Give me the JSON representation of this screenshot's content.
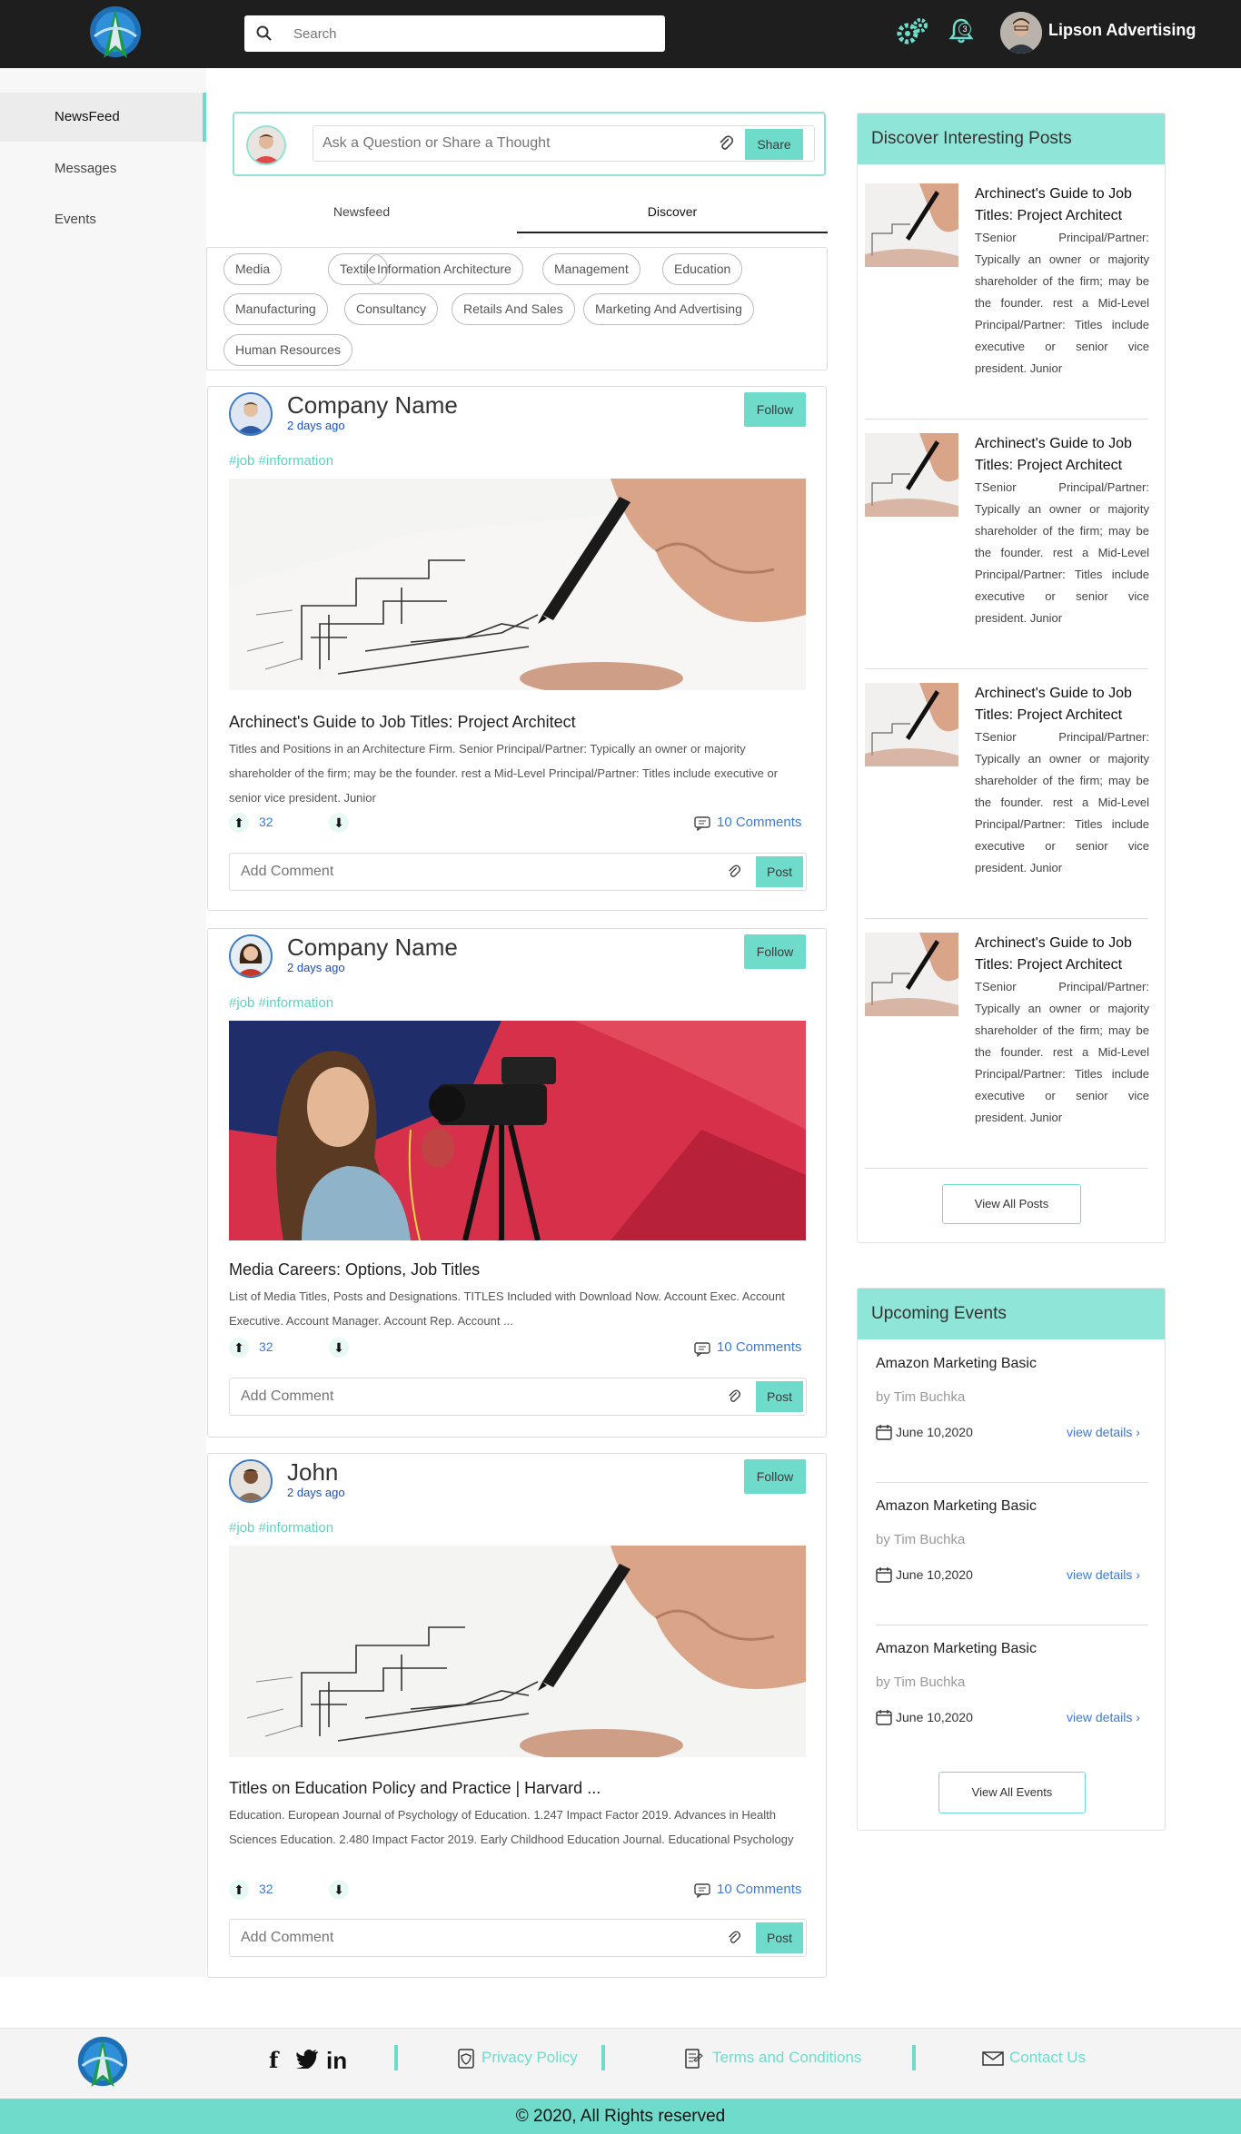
{
  "header": {
    "search_placeholder": "Search",
    "notification_count": "3",
    "username": "Lipson Advertising"
  },
  "sidebar": {
    "items": [
      {
        "label": "NewsFeed",
        "active": true
      },
      {
        "label": "Messages",
        "active": false
      },
      {
        "label": "Events",
        "active": false
      }
    ]
  },
  "composer": {
    "placeholder": "Ask a Question or Share a Thought",
    "share_label": "Share"
  },
  "tabs": [
    {
      "label": "Newsfeed",
      "active": false
    },
    {
      "label": "Discover",
      "active": true
    }
  ],
  "categories": [
    "Media",
    "Textile",
    "Information Architecture",
    "Management",
    "Education",
    "Manufacturing",
    "Consultancy",
    "Retails And Sales",
    "Marketing And Advertising",
    "Human Resources"
  ],
  "posts": [
    {
      "author": "Company Name",
      "time": "2 days ago",
      "follow_label": "Follow",
      "hashtags": "#job #information",
      "title": "Archinect's Guide to Job Titles: Project Architect",
      "body": "Titles and Positions in an Architecture Firm. Senior Principal/Partner: Typically an owner or majority shareholder of the firm; may be the founder. rest a Mid-Level Principal/Partner: Titles include executive or senior vice president. Junior",
      "votes": "32",
      "comments": "10 Comments",
      "comment_placeholder": "Add Comment",
      "post_label": "Post"
    },
    {
      "author": "Company Name",
      "time": "2 days ago",
      "follow_label": "Follow",
      "hashtags": "#job #information",
      "title": "Media Careers: Options, Job Titles",
      "body": "List of Media Titles, Posts and Designations. TITLES Included with Download Now. Account Exec. Account Executive. Account Manager. Account Rep. Account ...",
      "votes": "32",
      "comments": "10 Comments",
      "comment_placeholder": "Add Comment",
      "post_label": "Post"
    },
    {
      "author": "John",
      "time": "2 days ago",
      "follow_label": "Follow",
      "hashtags": "#job #information",
      "title": "Titles on Education Policy and Practice | Harvard ...",
      "body": "Education. European Journal of Psychology of Education. 1.247 Impact Factor 2019. Advances in Health Sciences Education. 2.480 Impact Factor 2019. Early Childhood Education Journal. Educational Psychology",
      "votes": "32",
      "comments": "10 Comments",
      "comment_placeholder": "Add Comment",
      "post_label": "Post"
    }
  ],
  "discover": {
    "heading": "Discover Interesting Posts",
    "items": [
      {
        "title": "Archinect's Guide to Job Titles: Project Architect",
        "body": "TSenior Principal/Partner: Typically an owner or majority shareholder of the firm; may be the founder. rest a Mid-Level Principal/Partner: Titles include executive or senior vice president. Junior"
      },
      {
        "title": "Archinect's Guide to Job Titles: Project Architect",
        "body": "TSenior Principal/Partner: Typically an owner or majority shareholder of the firm; may be the founder. rest a Mid-Level Principal/Partner: Titles include executive or senior vice president. Junior"
      },
      {
        "title": "Archinect's Guide to Job Titles: Project Architect",
        "body": "TSenior Principal/Partner: Typically an owner or majority shareholder of the firm; may be the founder. rest a Mid-Level Principal/Partner: Titles include executive or senior vice president. Junior"
      },
      {
        "title": "Archinect's Guide to Job Titles: Project Architect",
        "body": "TSenior Principal/Partner: Typically an owner or majority shareholder of the firm; may be the founder. rest a Mid-Level Principal/Partner: Titles include executive or senior vice president. Junior"
      }
    ],
    "view_all": "View All Posts"
  },
  "events": {
    "heading": "Upcoming Events",
    "items": [
      {
        "title": "Amazon Marketing Basic",
        "by": "by Tim Buchka",
        "date": "June 10,2020",
        "link": "view details"
      },
      {
        "title": "Amazon Marketing Basic",
        "by": "by Tim Buchka",
        "date": "June 10,2020",
        "link": "view details"
      },
      {
        "title": "Amazon Marketing Basic",
        "by": "by Tim Buchka",
        "date": "June 10,2020",
        "link": "view details"
      }
    ],
    "view_all": "View All Events"
  },
  "footer": {
    "links": [
      "Privacy Policy",
      "Terms and Conditions",
      "Contact Us"
    ],
    "copyright": "© 2020, All Rights reserved"
  },
  "colors": {
    "accent": "#6fdccb",
    "header_bg": "#1e1e1e",
    "link": "#3b7ad6"
  }
}
